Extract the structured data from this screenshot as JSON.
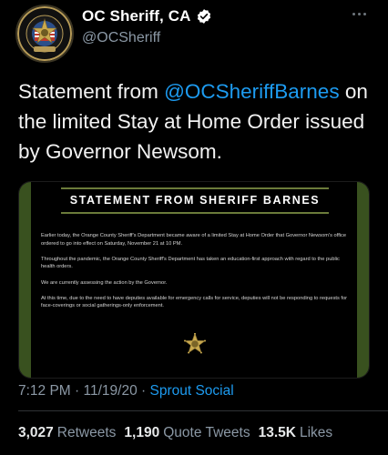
{
  "colors": {
    "background": "#000000",
    "link": "#1d9bf0",
    "secondary_text": "#8b98a5",
    "card_accent": "#39511f"
  },
  "author": {
    "display_name": "OC Sheriff, CA",
    "handle": "@OCSheriff",
    "verified": true,
    "avatar": {
      "icon": "sheriff-seal-icon",
      "seal_text_top": "ORANGE COUNTY SHERIFF'S DEPARTMENT",
      "seal_text_bottom": "EST. 1889"
    }
  },
  "tweet": {
    "text_before": "Statement from ",
    "mention": "@OCSheriffBarnes",
    "text_after": " on the limited Stay at Home Order issued by Governor Newsom."
  },
  "image": {
    "heading": "STATEMENT FROM SHERIFF BARNES",
    "paragraphs": [
      "Earlier today, the Orange County Sheriff's Department became aware of a limited Stay at Home Order that Governor Newsom's office ordered to go into effect on Saturday, November 21 at 10 PM.",
      "Throughout the pandemic, the Orange County Sheriff's Department has taken an education-first approach with regard to the public health orders.",
      "We are currently assessing the action by the Governor.",
      "At this time, due to the need to have deputies available for emergency calls for service, deputies will not be responding to requests for face-coverings or social gatherings-only enforcement."
    ],
    "badge_icon": "sheriff-star-badge-icon"
  },
  "meta": {
    "time": "7:12 PM",
    "separator": " · ",
    "date": "11/19/20",
    "source": "Sprout Social"
  },
  "stats": [
    {
      "count": "3,027",
      "label": "Retweets"
    },
    {
      "count": "1,190",
      "label": "Quote Tweets"
    },
    {
      "count": "13.5K",
      "label": "Likes"
    }
  ]
}
